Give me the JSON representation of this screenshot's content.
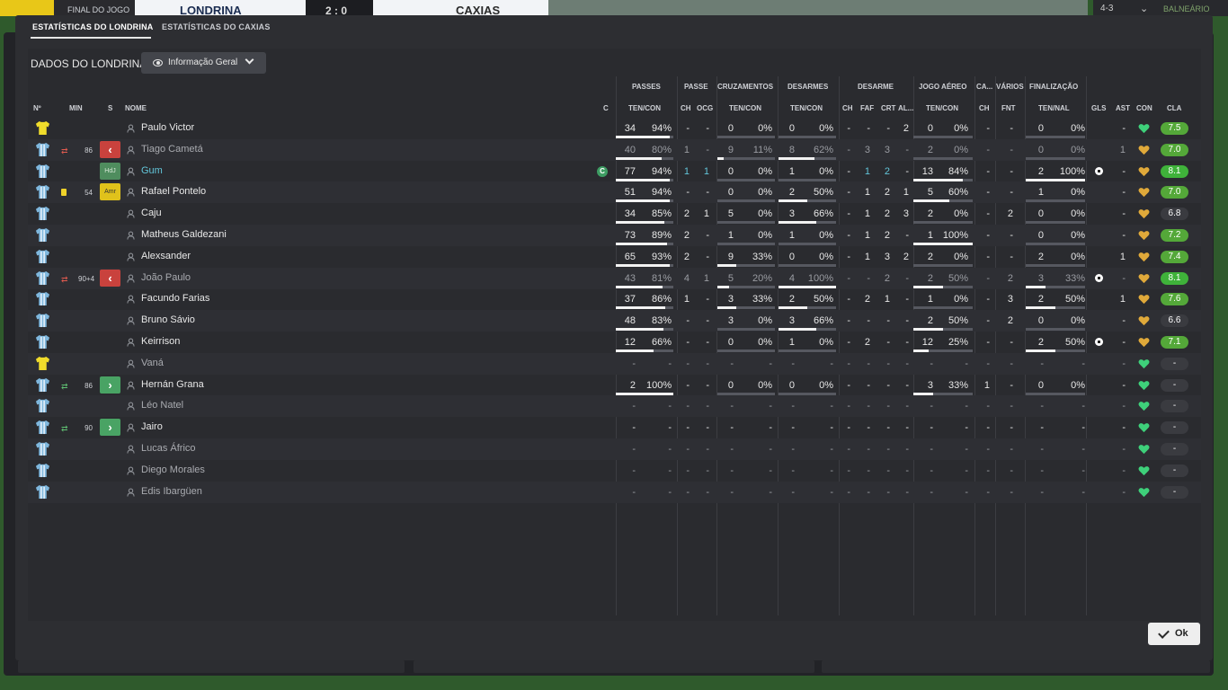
{
  "topbar": {
    "full_time": "FINAL DO JOGO",
    "home_team": "LONDRINA",
    "score": "2 : 0",
    "away_team": "CAXIAS",
    "right_code": "4-3",
    "right_link": "BALNEÁRIO"
  },
  "tabs": [
    {
      "label": "ESTATÍSTICAS DO LONDRINA",
      "active": true
    },
    {
      "label": "ESTATÍSTICAS DO CAXIAS",
      "active": false
    }
  ],
  "section_title": "DADOS DO LONDRINA",
  "dropdown_label": "Informação Geral",
  "group_headers": {
    "passes": "PASSES",
    "passe": "PASSE",
    "cruzamentos": "CRUZAMENTOS",
    "desarmes": "DESARMES",
    "desarme": "DESARME",
    "jogo_aereo": "JOGO AÉREO",
    "ca": "CA...",
    "varios": "VÁRIOS",
    "finalizacao": "FINALIZAÇÃO"
  },
  "headers": {
    "no": "Nº",
    "min": "MIN",
    "s": "S",
    "nome": "NOME",
    "c": "C",
    "ten_con_p": "TEN/CON",
    "ch": "CH",
    "ocg": "OCG",
    "ten_con_c": "TEN/CON",
    "ten_con_d": "TEN/CON",
    "ch2": "CH",
    "faf": "FAF",
    "crt": "CRT",
    "al": "AL...",
    "ten_con_a": "TEN/CON",
    "ch3": "CH",
    "fnt": "FNT",
    "ten_nal": "TEN/NAL",
    "gls": "GLS",
    "ast": "AST",
    "con": "CON",
    "cla": "CLA"
  },
  "players": [
    {
      "name": "Paulo Victor",
      "gk": true,
      "sub": "",
      "min": "",
      "status": "",
      "cap": false,
      "dim": false,
      "cyan": false,
      "p": [
        "34",
        "94%"
      ],
      "pf": 0.94,
      "pch": "-",
      "pocg": "-",
      "cr": [
        "0",
        "0%"
      ],
      "crf": 0,
      "de": [
        "0",
        "0%"
      ],
      "def": 0,
      "dch": "-",
      "faf": "-",
      "crt": "-",
      "al": "2",
      "ae": [
        "0",
        "0%"
      ],
      "aef": 0,
      "ca": "-",
      "fnt": "-",
      "fi": [
        "0",
        "0%"
      ],
      "fif": 0,
      "gls": "",
      "ast": "-",
      "heart": "green",
      "rating": "7.5",
      "rcolor": "#54a839"
    },
    {
      "name": "Tiago Cametá",
      "gk": false,
      "sub": "off",
      "min": "86",
      "status": "red",
      "cap": false,
      "dim": true,
      "cyan": false,
      "p": [
        "40",
        "80%"
      ],
      "pf": 0.8,
      "pch": "1",
      "pocg": "-",
      "cr": [
        "9",
        "11%"
      ],
      "crf": 0.11,
      "de": [
        "8",
        "62%"
      ],
      "def": 0.62,
      "dch": "-",
      "faf": "3",
      "crt": "3",
      "al": "-",
      "ae": [
        "2",
        "0%"
      ],
      "aef": 0,
      "ca": "-",
      "fnt": "-",
      "fi": [
        "0",
        "0%"
      ],
      "fif": 0,
      "gls": "",
      "ast": "1",
      "heart": "gold",
      "rating": "7.0",
      "rcolor": "#54a839"
    },
    {
      "name": "Gum",
      "gk": false,
      "sub": "",
      "min": "",
      "status": "hdj",
      "status_label": "HdJ",
      "cap": true,
      "cap_label": "C",
      "dim": false,
      "cyan": true,
      "p": [
        "77",
        "94%"
      ],
      "pf": 0.94,
      "pch": "1",
      "pocg": "1",
      "cr": [
        "0",
        "0%"
      ],
      "crf": 0,
      "de": [
        "1",
        "0%"
      ],
      "def": 0,
      "dch": "-",
      "faf": "1",
      "crt": "2",
      "al": "-",
      "ae": [
        "13",
        "84%"
      ],
      "aef": 0.84,
      "ca": "-",
      "fnt": "-",
      "fi": [
        "2",
        "100%"
      ],
      "fif": 1,
      "gls": "ball",
      "ast": "-",
      "heart": "gold",
      "rating": "8.1",
      "rcolor": "#3fb23a"
    },
    {
      "name": "Rafael Pontelo",
      "gk": false,
      "sub": "card",
      "min": "54",
      "status": "amr",
      "status_label": "Amr",
      "cap": false,
      "dim": false,
      "cyan": false,
      "p": [
        "51",
        "94%"
      ],
      "pf": 0.94,
      "pch": "-",
      "pocg": "-",
      "cr": [
        "0",
        "0%"
      ],
      "crf": 0,
      "de": [
        "2",
        "50%"
      ],
      "def": 0.5,
      "dch": "-",
      "faf": "1",
      "crt": "2",
      "al": "1",
      "ae": [
        "5",
        "60%"
      ],
      "aef": 0.6,
      "ca": "-",
      "fnt": "-",
      "fi": [
        "1",
        "0%"
      ],
      "fif": 0,
      "gls": "",
      "ast": "-",
      "heart": "gold",
      "rating": "7.0",
      "rcolor": "#54a839"
    },
    {
      "name": "Caju",
      "gk": false,
      "sub": "",
      "min": "",
      "status": "",
      "cap": false,
      "dim": false,
      "cyan": false,
      "p": [
        "34",
        "85%"
      ],
      "pf": 0.85,
      "pch": "2",
      "pocg": "1",
      "cr": [
        "5",
        "0%"
      ],
      "crf": 0,
      "de": [
        "3",
        "66%"
      ],
      "def": 0.66,
      "dch": "-",
      "faf": "1",
      "crt": "2",
      "al": "3",
      "ae": [
        "2",
        "0%"
      ],
      "aef": 0,
      "ca": "-",
      "fnt": "2",
      "fi": [
        "0",
        "0%"
      ],
      "fif": 0,
      "gls": "",
      "ast": "-",
      "heart": "gold",
      "rating": "6.8",
      "rcolor": "#3a3b40"
    },
    {
      "name": "Matheus Galdezani",
      "gk": false,
      "sub": "",
      "min": "",
      "status": "",
      "cap": false,
      "dim": false,
      "cyan": false,
      "p": [
        "73",
        "89%"
      ],
      "pf": 0.89,
      "pch": "2",
      "pocg": "-",
      "cr": [
        "1",
        "0%"
      ],
      "crf": 0,
      "de": [
        "1",
        "0%"
      ],
      "def": 0,
      "dch": "-",
      "faf": "1",
      "crt": "2",
      "al": "-",
      "ae": [
        "1",
        "100%"
      ],
      "aef": 1,
      "ca": "-",
      "fnt": "-",
      "fi": [
        "0",
        "0%"
      ],
      "fif": 0,
      "gls": "",
      "ast": "-",
      "heart": "gold",
      "rating": "7.2",
      "rcolor": "#54a839"
    },
    {
      "name": "Alexsander",
      "gk": false,
      "sub": "",
      "min": "",
      "status": "",
      "cap": false,
      "dim": false,
      "cyan": false,
      "p": [
        "65",
        "93%"
      ],
      "pf": 0.93,
      "pch": "2",
      "pocg": "-",
      "cr": [
        "9",
        "33%"
      ],
      "crf": 0.33,
      "de": [
        "0",
        "0%"
      ],
      "def": 0,
      "dch": "-",
      "faf": "1",
      "crt": "3",
      "al": "2",
      "ae": [
        "2",
        "0%"
      ],
      "aef": 0,
      "ca": "-",
      "fnt": "-",
      "fi": [
        "2",
        "0%"
      ],
      "fif": 0,
      "gls": "",
      "ast": "1",
      "heart": "gold",
      "rating": "7.4",
      "rcolor": "#54a839"
    },
    {
      "name": "João Paulo",
      "gk": false,
      "sub": "off",
      "min": "90+4",
      "status": "red",
      "cap": false,
      "dim": true,
      "cyan": false,
      "p": [
        "43",
        "81%"
      ],
      "pf": 0.81,
      "pch": "4",
      "pocg": "1",
      "cr": [
        "5",
        "20%"
      ],
      "crf": 0.2,
      "de": [
        "4",
        "100%"
      ],
      "def": 1,
      "dch": "-",
      "faf": "-",
      "crt": "2",
      "al": "-",
      "ae": [
        "2",
        "50%"
      ],
      "aef": 0.5,
      "ca": "-",
      "fnt": "2",
      "fi": [
        "3",
        "33%"
      ],
      "fif": 0.33,
      "gls": "ball",
      "ast": "-",
      "heart": "gold",
      "rating": "8.1",
      "rcolor": "#3fb23a"
    },
    {
      "name": "Facundo Farias",
      "gk": false,
      "sub": "",
      "min": "",
      "status": "",
      "cap": false,
      "dim": false,
      "cyan": false,
      "p": [
        "37",
        "86%"
      ],
      "pf": 0.86,
      "pch": "1",
      "pocg": "-",
      "cr": [
        "3",
        "33%"
      ],
      "crf": 0.33,
      "de": [
        "2",
        "50%"
      ],
      "def": 0.5,
      "dch": "-",
      "faf": "2",
      "crt": "1",
      "al": "-",
      "ae": [
        "1",
        "0%"
      ],
      "aef": 0,
      "ca": "-",
      "fnt": "3",
      "fi": [
        "2",
        "50%"
      ],
      "fif": 0.5,
      "gls": "",
      "ast": "1",
      "heart": "gold",
      "rating": "7.6",
      "rcolor": "#54a839"
    },
    {
      "name": "Bruno Sávio",
      "gk": false,
      "sub": "",
      "min": "",
      "status": "",
      "cap": false,
      "dim": false,
      "cyan": false,
      "p": [
        "48",
        "83%"
      ],
      "pf": 0.83,
      "pch": "-",
      "pocg": "-",
      "cr": [
        "3",
        "0%"
      ],
      "crf": 0,
      "de": [
        "3",
        "66%"
      ],
      "def": 0.66,
      "dch": "-",
      "faf": "-",
      "crt": "-",
      "al": "-",
      "ae": [
        "2",
        "50%"
      ],
      "aef": 0.5,
      "ca": "-",
      "fnt": "2",
      "fi": [
        "0",
        "0%"
      ],
      "fif": 0,
      "gls": "",
      "ast": "-",
      "heart": "gold",
      "rating": "6.6",
      "rcolor": "#3a3b40"
    },
    {
      "name": "Keirrison",
      "gk": false,
      "sub": "",
      "min": "",
      "status": "",
      "cap": false,
      "dim": false,
      "cyan": false,
      "p": [
        "12",
        "66%"
      ],
      "pf": 0.66,
      "pch": "-",
      "pocg": "-",
      "cr": [
        "0",
        "0%"
      ],
      "crf": 0,
      "de": [
        "1",
        "0%"
      ],
      "def": 0,
      "dch": "-",
      "faf": "2",
      "crt": "-",
      "al": "-",
      "ae": [
        "12",
        "25%"
      ],
      "aef": 0.25,
      "ca": "-",
      "fnt": "-",
      "fi": [
        "2",
        "50%"
      ],
      "fif": 0.5,
      "gls": "ball",
      "ast": "-",
      "heart": "gold",
      "rating": "7.1",
      "rcolor": "#54a839"
    },
    {
      "name": "Vaná",
      "gk": true,
      "sub": "",
      "min": "",
      "status": "",
      "cap": false,
      "dim": true,
      "cyan": false,
      "p": [
        "-",
        "-"
      ],
      "pf": null,
      "pch": "-",
      "pocg": "-",
      "cr": [
        "-",
        "-"
      ],
      "crf": null,
      "de": [
        "-",
        "-"
      ],
      "def": null,
      "dch": "-",
      "faf": "-",
      "crt": "-",
      "al": "-",
      "ae": [
        "-",
        "-"
      ],
      "aef": null,
      "ca": "-",
      "fnt": "-",
      "fi": [
        "-",
        "-"
      ],
      "fif": null,
      "gls": "",
      "ast": "-",
      "heart": "green",
      "rating": "-",
      "rcolor": "#3a3b40"
    },
    {
      "name": "Hernán Grana",
      "gk": false,
      "sub": "on",
      "min": "86",
      "status": "green",
      "cap": false,
      "dim": false,
      "cyan": false,
      "p": [
        "2",
        "100%"
      ],
      "pf": 1,
      "pch": "-",
      "pocg": "-",
      "cr": [
        "0",
        "0%"
      ],
      "crf": 0,
      "de": [
        "0",
        "0%"
      ],
      "def": 0,
      "dch": "-",
      "faf": "-",
      "crt": "-",
      "al": "-",
      "ae": [
        "3",
        "33%"
      ],
      "aef": 0.33,
      "ca": "1",
      "fnt": "-",
      "fi": [
        "0",
        "0%"
      ],
      "fif": 0,
      "gls": "",
      "ast": "-",
      "heart": "green",
      "rating": "-",
      "rcolor": "#3a3b40"
    },
    {
      "name": "Léo Natel",
      "gk": false,
      "sub": "",
      "min": "",
      "status": "",
      "cap": false,
      "dim": true,
      "cyan": false,
      "p": [
        "-",
        "-"
      ],
      "pf": null,
      "pch": "-",
      "pocg": "-",
      "cr": [
        "-",
        "-"
      ],
      "crf": null,
      "de": [
        "-",
        "-"
      ],
      "def": null,
      "dch": "-",
      "faf": "-",
      "crt": "-",
      "al": "-",
      "ae": [
        "-",
        "-"
      ],
      "aef": null,
      "ca": "-",
      "fnt": "-",
      "fi": [
        "-",
        "-"
      ],
      "fif": null,
      "gls": "",
      "ast": "-",
      "heart": "green",
      "rating": "-",
      "rcolor": "#3a3b40"
    },
    {
      "name": "Jairo",
      "gk": false,
      "sub": "on",
      "min": "90",
      "status": "green",
      "cap": false,
      "dim": false,
      "cyan": false,
      "p": [
        "-",
        "-"
      ],
      "pf": null,
      "pch": "-",
      "pocg": "-",
      "cr": [
        "-",
        "-"
      ],
      "crf": null,
      "de": [
        "-",
        "-"
      ],
      "def": null,
      "dch": "-",
      "faf": "-",
      "crt": "-",
      "al": "-",
      "ae": [
        "-",
        "-"
      ],
      "aef": null,
      "ca": "-",
      "fnt": "-",
      "fi": [
        "-",
        "-"
      ],
      "fif": null,
      "gls": "",
      "ast": "-",
      "heart": "green",
      "rating": "-",
      "rcolor": "#3a3b40"
    },
    {
      "name": "Lucas Áfrico",
      "gk": false,
      "sub": "",
      "min": "",
      "status": "",
      "cap": false,
      "dim": true,
      "cyan": false,
      "p": [
        "-",
        "-"
      ],
      "pf": null,
      "pch": "-",
      "pocg": "-",
      "cr": [
        "-",
        "-"
      ],
      "crf": null,
      "de": [
        "-",
        "-"
      ],
      "def": null,
      "dch": "-",
      "faf": "-",
      "crt": "-",
      "al": "-",
      "ae": [
        "-",
        "-"
      ],
      "aef": null,
      "ca": "-",
      "fnt": "-",
      "fi": [
        "-",
        "-"
      ],
      "fif": null,
      "gls": "",
      "ast": "-",
      "heart": "green",
      "rating": "-",
      "rcolor": "#3a3b40"
    },
    {
      "name": "Diego Morales",
      "gk": false,
      "sub": "",
      "min": "",
      "status": "",
      "cap": false,
      "dim": true,
      "cyan": false,
      "p": [
        "-",
        "-"
      ],
      "pf": null,
      "pch": "-",
      "pocg": "-",
      "cr": [
        "-",
        "-"
      ],
      "crf": null,
      "de": [
        "-",
        "-"
      ],
      "def": null,
      "dch": "-",
      "faf": "-",
      "crt": "-",
      "al": "-",
      "ae": [
        "-",
        "-"
      ],
      "aef": null,
      "ca": "-",
      "fnt": "-",
      "fi": [
        "-",
        "-"
      ],
      "fif": null,
      "gls": "",
      "ast": "-",
      "heart": "green",
      "rating": "-",
      "rcolor": "#3a3b40"
    },
    {
      "name": "Edis Ibargüen",
      "gk": false,
      "sub": "",
      "min": "",
      "status": "",
      "cap": false,
      "dim": true,
      "cyan": false,
      "p": [
        "-",
        "-"
      ],
      "pf": null,
      "pch": "-",
      "pocg": "-",
      "cr": [
        "-",
        "-"
      ],
      "crf": null,
      "de": [
        "-",
        "-"
      ],
      "def": null,
      "dch": "-",
      "faf": "-",
      "crt": "-",
      "al": "-",
      "ae": [
        "-",
        "-"
      ],
      "aef": null,
      "ca": "-",
      "fnt": "-",
      "fi": [
        "-",
        "-"
      ],
      "fif": null,
      "gls": "",
      "ast": "-",
      "heart": "green",
      "rating": "-",
      "rcolor": "#3a3b40"
    }
  ],
  "colors": {
    "accent_cyan": "#62c5d9",
    "sub_off": "#c9423d",
    "sub_on": "#49a364",
    "heart_green": "#3ed07a",
    "heart_gold": "#e0a93a",
    "gk_yellow": "#f0dc2b",
    "outfield_shirt": "#7fb7dd"
  },
  "ok_label": "Ok"
}
